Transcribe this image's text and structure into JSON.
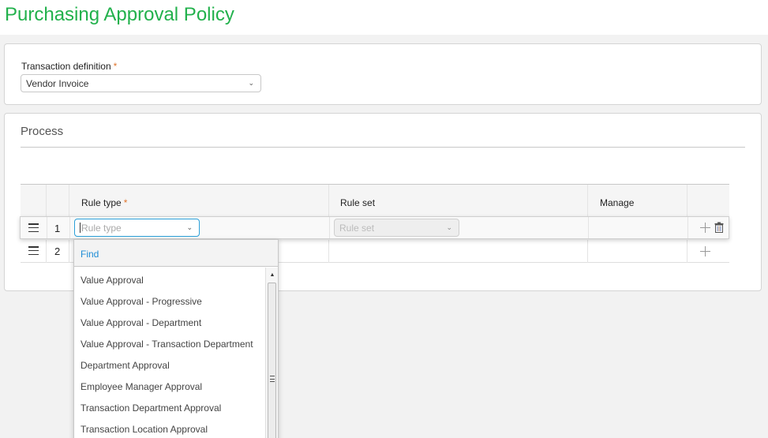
{
  "page": {
    "title": "Purchasing Approval Policy",
    "title_color": "#22b14c",
    "accent_color": "#2a9fd8",
    "required_color": "#e0762f"
  },
  "transaction": {
    "label": "Transaction definition",
    "required_mark": "*",
    "value": "Vendor Invoice",
    "chevron_icon": "chevron-down-icon"
  },
  "process": {
    "title": "Process",
    "columns": {
      "rule_type": "Rule type",
      "rule_type_required": "*",
      "rule_set": "Rule set",
      "manage": "Manage"
    },
    "rows": [
      {
        "number": "1",
        "rule_type_placeholder": "Rule type",
        "rule_set_placeholder": "Rule set",
        "actions": [
          "add",
          "delete"
        ]
      },
      {
        "number": "2",
        "actions": [
          "add"
        ]
      }
    ]
  },
  "dropdown": {
    "find_label": "Find",
    "options": [
      "Value Approval",
      "Value Approval - Progressive",
      "Value Approval - Department",
      "Value Approval - Transaction Department",
      "Department Approval",
      "Employee Manager Approval",
      "Transaction Department Approval",
      "Transaction Location Approval"
    ]
  },
  "glyphs": {
    "chevron": "⌄",
    "scroll_up": "▲"
  }
}
